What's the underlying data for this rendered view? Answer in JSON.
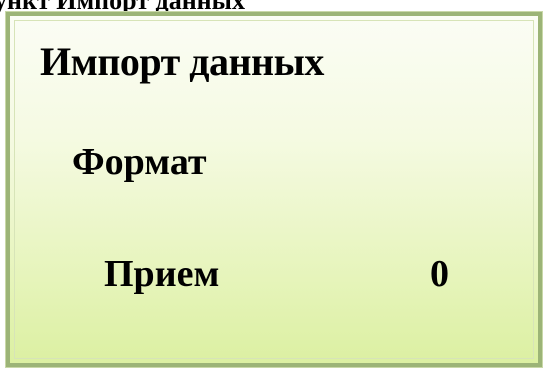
{
  "caption": "ункт Импорт данных",
  "screen": {
    "title": "Импорт данных",
    "format_label": "Формат",
    "receive_label": "Прием",
    "receive_value": "0"
  }
}
